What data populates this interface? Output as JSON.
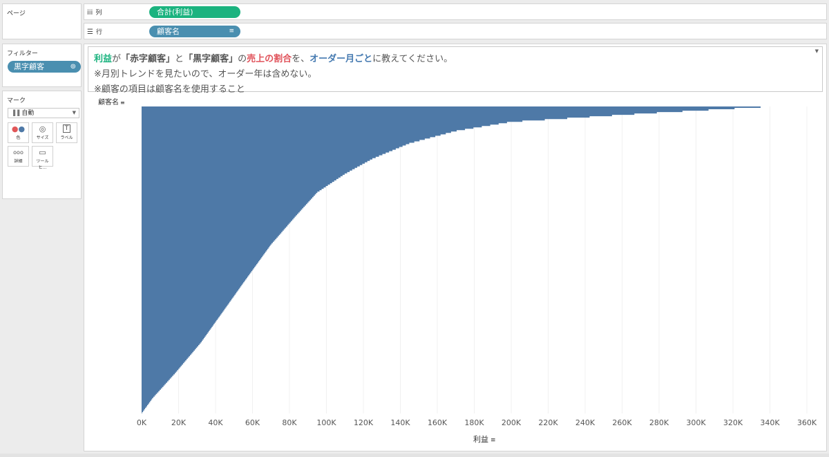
{
  "sidebar": {
    "pages_title": "ページ",
    "filters_title": "フィルター",
    "filter_pill": "黒字顧客",
    "marks_title": "マーク",
    "mark_type": "自動",
    "buttons": [
      {
        "label": "色",
        "icon": "dots-icon"
      },
      {
        "label": "サイズ",
        "icon": "size-icon"
      },
      {
        "label": "ラベル",
        "icon": "label-icon"
      },
      {
        "label": "詳細",
        "icon": "detail-icon"
      },
      {
        "label": "ツールヒ…",
        "icon": "tooltip-icon"
      }
    ]
  },
  "shelves": {
    "columns_label": "列",
    "columns_pill": "合計(利益)",
    "rows_label": "行",
    "rows_pill": "顧客名"
  },
  "title": {
    "line1_parts": [
      "利益",
      "が",
      "「赤字顧客」",
      "と",
      "「黒字顧客」",
      "の",
      "売上の割合",
      "を、",
      "オーダー月ごと",
      "に教えてください。"
    ],
    "line2": "※月別トレンドを見たいので、オーダー年は含めない。",
    "line3": "※顧客の項目は顧客名を使用すること"
  },
  "chart_data": {
    "type": "bar",
    "orientation": "horizontal",
    "sorted": "descending",
    "color": "#4e79a7",
    "x_axis_label": "利益",
    "y_axis_label": "顧客名",
    "x_ticks": [
      "0K",
      "20K",
      "40K",
      "60K",
      "80K",
      "100K",
      "120K",
      "140K",
      "160K",
      "180K",
      "200K",
      "220K",
      "240K",
      "260K",
      "280K",
      "300K",
      "320K",
      "340K",
      "360K"
    ],
    "xlim": [
      0,
      360000
    ],
    "series_profile": {
      "fraction_of_customers": [
        0,
        0.02,
        0.05,
        0.08,
        0.12,
        0.17,
        0.22,
        0.28,
        0.36,
        0.45,
        0.55,
        0.66,
        0.77,
        0.87,
        0.95,
        1.0
      ],
      "profit": [
        342000,
        280000,
        200000,
        170000,
        145000,
        125000,
        110000,
        95000,
        83000,
        70000,
        58000,
        45000,
        32000,
        18000,
        6000,
        0
      ]
    }
  }
}
